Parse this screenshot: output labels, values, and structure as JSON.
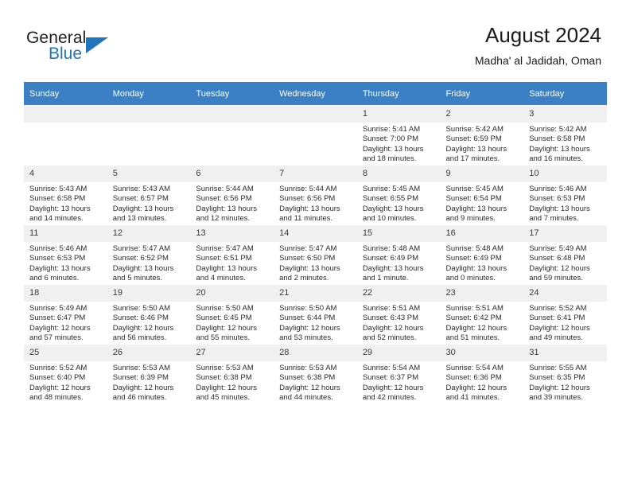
{
  "logo": {
    "word_top": "General",
    "word_bottom": "Blue",
    "triangle_color": "#1f76bd",
    "icon": "general-blue-logo"
  },
  "header": {
    "title": "August 2024",
    "subtitle": "Madha' al Jadidah, Oman"
  },
  "theme": {
    "header_bar": "#3b7fc4",
    "daynum_bg": "#f0f0f0",
    "text": "#2b2b2b"
  },
  "calendar": {
    "weekday_headers": [
      "Sunday",
      "Monday",
      "Tuesday",
      "Wednesday",
      "Thursday",
      "Friday",
      "Saturday"
    ],
    "leading_blanks": 4,
    "days": [
      {
        "n": "1",
        "sunrise": "Sunrise: 5:41 AM",
        "sunset": "Sunset: 7:00 PM",
        "daylight1": "Daylight: 13 hours",
        "daylight2": "and 18 minutes."
      },
      {
        "n": "2",
        "sunrise": "Sunrise: 5:42 AM",
        "sunset": "Sunset: 6:59 PM",
        "daylight1": "Daylight: 13 hours",
        "daylight2": "and 17 minutes."
      },
      {
        "n": "3",
        "sunrise": "Sunrise: 5:42 AM",
        "sunset": "Sunset: 6:58 PM",
        "daylight1": "Daylight: 13 hours",
        "daylight2": "and 16 minutes."
      },
      {
        "n": "4",
        "sunrise": "Sunrise: 5:43 AM",
        "sunset": "Sunset: 6:58 PM",
        "daylight1": "Daylight: 13 hours",
        "daylight2": "and 14 minutes."
      },
      {
        "n": "5",
        "sunrise": "Sunrise: 5:43 AM",
        "sunset": "Sunset: 6:57 PM",
        "daylight1": "Daylight: 13 hours",
        "daylight2": "and 13 minutes."
      },
      {
        "n": "6",
        "sunrise": "Sunrise: 5:44 AM",
        "sunset": "Sunset: 6:56 PM",
        "daylight1": "Daylight: 13 hours",
        "daylight2": "and 12 minutes."
      },
      {
        "n": "7",
        "sunrise": "Sunrise: 5:44 AM",
        "sunset": "Sunset: 6:56 PM",
        "daylight1": "Daylight: 13 hours",
        "daylight2": "and 11 minutes."
      },
      {
        "n": "8",
        "sunrise": "Sunrise: 5:45 AM",
        "sunset": "Sunset: 6:55 PM",
        "daylight1": "Daylight: 13 hours",
        "daylight2": "and 10 minutes."
      },
      {
        "n": "9",
        "sunrise": "Sunrise: 5:45 AM",
        "sunset": "Sunset: 6:54 PM",
        "daylight1": "Daylight: 13 hours",
        "daylight2": "and 9 minutes."
      },
      {
        "n": "10",
        "sunrise": "Sunrise: 5:46 AM",
        "sunset": "Sunset: 6:53 PM",
        "daylight1": "Daylight: 13 hours",
        "daylight2": "and 7 minutes."
      },
      {
        "n": "11",
        "sunrise": "Sunrise: 5:46 AM",
        "sunset": "Sunset: 6:53 PM",
        "daylight1": "Daylight: 13 hours",
        "daylight2": "and 6 minutes."
      },
      {
        "n": "12",
        "sunrise": "Sunrise: 5:47 AM",
        "sunset": "Sunset: 6:52 PM",
        "daylight1": "Daylight: 13 hours",
        "daylight2": "and 5 minutes."
      },
      {
        "n": "13",
        "sunrise": "Sunrise: 5:47 AM",
        "sunset": "Sunset: 6:51 PM",
        "daylight1": "Daylight: 13 hours",
        "daylight2": "and 4 minutes."
      },
      {
        "n": "14",
        "sunrise": "Sunrise: 5:47 AM",
        "sunset": "Sunset: 6:50 PM",
        "daylight1": "Daylight: 13 hours",
        "daylight2": "and 2 minutes."
      },
      {
        "n": "15",
        "sunrise": "Sunrise: 5:48 AM",
        "sunset": "Sunset: 6:49 PM",
        "daylight1": "Daylight: 13 hours",
        "daylight2": "and 1 minute."
      },
      {
        "n": "16",
        "sunrise": "Sunrise: 5:48 AM",
        "sunset": "Sunset: 6:49 PM",
        "daylight1": "Daylight: 13 hours",
        "daylight2": "and 0 minutes."
      },
      {
        "n": "17",
        "sunrise": "Sunrise: 5:49 AM",
        "sunset": "Sunset: 6:48 PM",
        "daylight1": "Daylight: 12 hours",
        "daylight2": "and 59 minutes."
      },
      {
        "n": "18",
        "sunrise": "Sunrise: 5:49 AM",
        "sunset": "Sunset: 6:47 PM",
        "daylight1": "Daylight: 12 hours",
        "daylight2": "and 57 minutes."
      },
      {
        "n": "19",
        "sunrise": "Sunrise: 5:50 AM",
        "sunset": "Sunset: 6:46 PM",
        "daylight1": "Daylight: 12 hours",
        "daylight2": "and 56 minutes."
      },
      {
        "n": "20",
        "sunrise": "Sunrise: 5:50 AM",
        "sunset": "Sunset: 6:45 PM",
        "daylight1": "Daylight: 12 hours",
        "daylight2": "and 55 minutes."
      },
      {
        "n": "21",
        "sunrise": "Sunrise: 5:50 AM",
        "sunset": "Sunset: 6:44 PM",
        "daylight1": "Daylight: 12 hours",
        "daylight2": "and 53 minutes."
      },
      {
        "n": "22",
        "sunrise": "Sunrise: 5:51 AM",
        "sunset": "Sunset: 6:43 PM",
        "daylight1": "Daylight: 12 hours",
        "daylight2": "and 52 minutes."
      },
      {
        "n": "23",
        "sunrise": "Sunrise: 5:51 AM",
        "sunset": "Sunset: 6:42 PM",
        "daylight1": "Daylight: 12 hours",
        "daylight2": "and 51 minutes."
      },
      {
        "n": "24",
        "sunrise": "Sunrise: 5:52 AM",
        "sunset": "Sunset: 6:41 PM",
        "daylight1": "Daylight: 12 hours",
        "daylight2": "and 49 minutes."
      },
      {
        "n": "25",
        "sunrise": "Sunrise: 5:52 AM",
        "sunset": "Sunset: 6:40 PM",
        "daylight1": "Daylight: 12 hours",
        "daylight2": "and 48 minutes."
      },
      {
        "n": "26",
        "sunrise": "Sunrise: 5:53 AM",
        "sunset": "Sunset: 6:39 PM",
        "daylight1": "Daylight: 12 hours",
        "daylight2": "and 46 minutes."
      },
      {
        "n": "27",
        "sunrise": "Sunrise: 5:53 AM",
        "sunset": "Sunset: 6:38 PM",
        "daylight1": "Daylight: 12 hours",
        "daylight2": "and 45 minutes."
      },
      {
        "n": "28",
        "sunrise": "Sunrise: 5:53 AM",
        "sunset": "Sunset: 6:38 PM",
        "daylight1": "Daylight: 12 hours",
        "daylight2": "and 44 minutes."
      },
      {
        "n": "29",
        "sunrise": "Sunrise: 5:54 AM",
        "sunset": "Sunset: 6:37 PM",
        "daylight1": "Daylight: 12 hours",
        "daylight2": "and 42 minutes."
      },
      {
        "n": "30",
        "sunrise": "Sunrise: 5:54 AM",
        "sunset": "Sunset: 6:36 PM",
        "daylight1": "Daylight: 12 hours",
        "daylight2": "and 41 minutes."
      },
      {
        "n": "31",
        "sunrise": "Sunrise: 5:55 AM",
        "sunset": "Sunset: 6:35 PM",
        "daylight1": "Daylight: 12 hours",
        "daylight2": "and 39 minutes."
      }
    ]
  }
}
